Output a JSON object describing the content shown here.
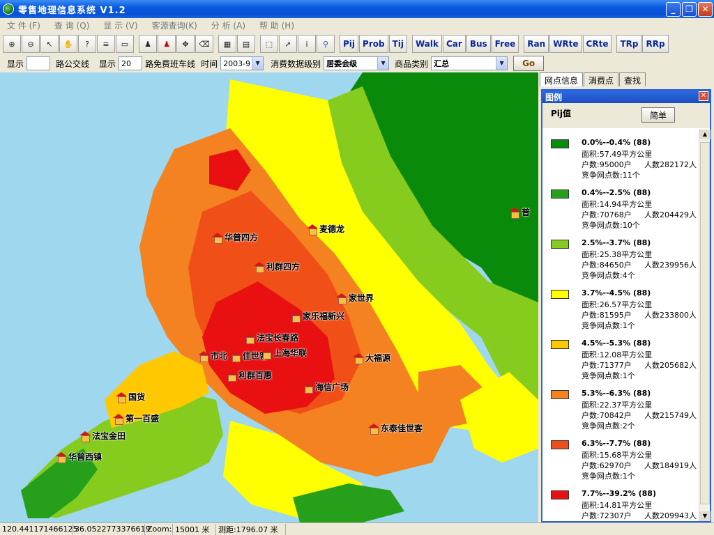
{
  "window": {
    "title": "零售地理信息系统 V1.2"
  },
  "menu": [
    "文 件 (F)",
    "查 询 (Q)",
    "显 示 (V)",
    "客源查询(K)",
    "分 析 (A)",
    "帮 助 (H)"
  ],
  "toolbar": {
    "buttons": [
      "Pij",
      "Prob",
      "Tij",
      "Walk",
      "Car",
      "Bus",
      "Free",
      "Ran",
      "WRte",
      "CRte",
      "TRp",
      "RRp"
    ]
  },
  "options": {
    "show_label_1": "显示",
    "show_value_1": "",
    "bus_label": "路公交线",
    "show_label_2": "显示",
    "show_value_2": "20",
    "free_bus_label": "路免费班车线",
    "time_label": "时间",
    "time_value": "2003-9",
    "level_label": "消费数据级别",
    "level_value": "居委会级",
    "category_label": "商品类别",
    "category_value": "汇总",
    "go_label": "Go"
  },
  "tabs": [
    "网点信息",
    "消费点",
    "查找"
  ],
  "legend": {
    "title": "图例",
    "field": "Pij值",
    "simple_button": "简单",
    "items": [
      {
        "range": "0.0%--0.4% (88)",
        "color": "#0a8a0a",
        "area": "面积:57.49平方公里",
        "households": "户数:95000户",
        "population": "人数282172人",
        "competitors": "竞争网点数:11个"
      },
      {
        "range": "0.4%--2.5% (88)",
        "color": "#26a01a",
        "area": "面积:14.94平方公里",
        "households": "户数:70768户",
        "population": "人数204429人",
        "competitors": "竞争网点数:10个"
      },
      {
        "range": "2.5%--3.7% (88)",
        "color": "#86cc1e",
        "area": "面积:25.38平方公里",
        "households": "户数:84650户",
        "population": "人数239956人",
        "competitors": "竞争网点数:4个"
      },
      {
        "range": "3.7%--4.5% (88)",
        "color": "#ffff00",
        "area": "面积:26.57平方公里",
        "households": "户数:81595户",
        "population": "人数233800人",
        "competitors": "竞争网点数:1个"
      },
      {
        "range": "4.5%--5.3% (88)",
        "color": "#ffc800",
        "area": "面积:12.08平方公里",
        "households": "户数:71377户",
        "population": "人数205682人",
        "competitors": "竞争网点数:1个"
      },
      {
        "range": "5.3%--6.3% (88)",
        "color": "#f58220",
        "area": "面积:22.37平方公里",
        "households": "户数:70842户",
        "population": "人数215749人",
        "competitors": "竞争网点数:2个"
      },
      {
        "range": "6.3%--7.7% (88)",
        "color": "#f05018",
        "area": "面积:15.68平方公里",
        "households": "户数:62970户",
        "population": "人数184919人",
        "competitors": "竞争网点数:1个"
      },
      {
        "range": "7.7%--39.2% (88)",
        "color": "#e81010",
        "area": "面积:14.81平方公里",
        "households": "户数:72307户",
        "population": "人数209943人",
        "competitors": ""
      }
    ]
  },
  "map": {
    "poi": [
      "华普四方",
      "麦德龙",
      "利群四方",
      "家世界",
      "家乐福新兴",
      "佳世客",
      "法宝长春路",
      "市北",
      "上海华联",
      "利群百惠",
      "大福源",
      "海信广场",
      "国货",
      "第一百盛",
      "法宝金田",
      "华普西镇",
      "东泰佳世客",
      "普"
    ]
  },
  "status": {
    "x": "120.441171466125",
    "y": "36.0522773376619",
    "zoom_label": "Zoom:",
    "zoom_value": "15001 米",
    "dist": "测距:1796.07 米"
  }
}
